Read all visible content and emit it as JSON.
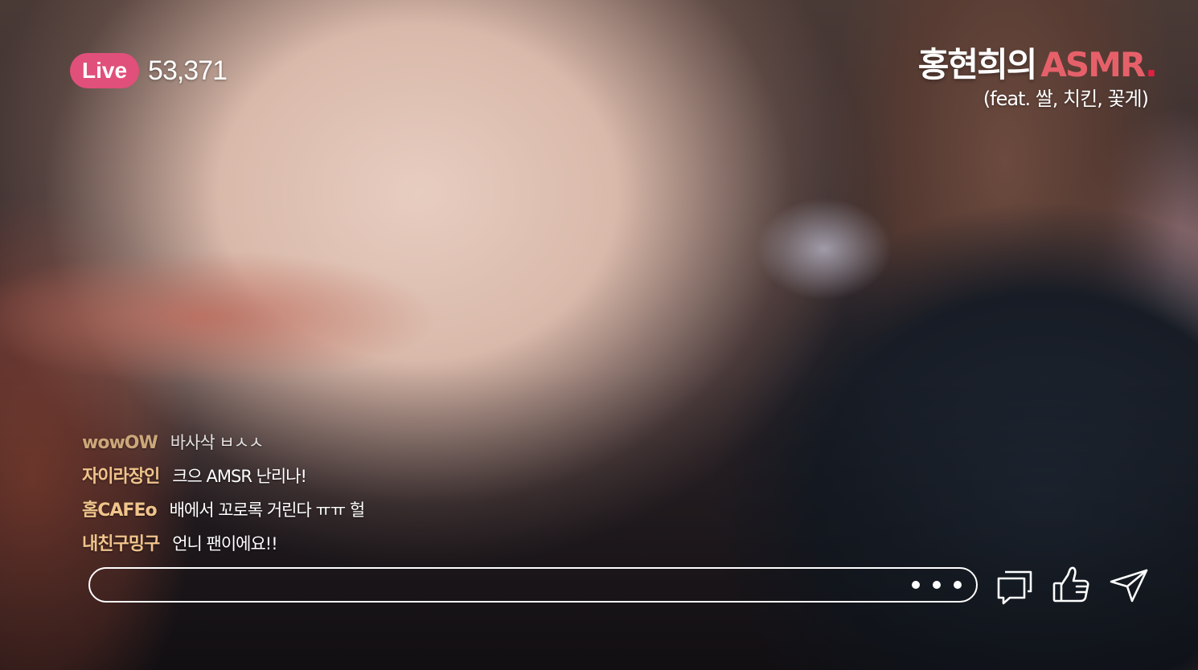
{
  "stream": {
    "live_label": "Live",
    "viewer_count": "53,371"
  },
  "title": {
    "main": "홍현희의",
    "accent": "ASMR",
    "dot": ".",
    "accent_color": "#e6606a",
    "subtitle": "(feat. 쌀, 치킨, 꽃게)"
  },
  "chat": {
    "messages": [
      {
        "user": "wowOW",
        "text": "바사삭 ㅂㅅㅅ"
      },
      {
        "user": "자이라장인",
        "text": "크으 AMSR 난리나!"
      },
      {
        "user": "홈CAFEo",
        "text": "배에서 꼬로록 거린다 ㅠㅠ 헐"
      },
      {
        "user": "내친구밍구",
        "text": "언니 팬이에요!!"
      }
    ]
  },
  "input": {
    "value": "",
    "placeholder": ""
  },
  "icons": {
    "more": "more-icon",
    "comments": "chat-bubble-icon",
    "like": "thumbs-up-icon",
    "share": "send-icon"
  },
  "colors": {
    "live_badge": "#e0507a",
    "username": "#f0c48c"
  }
}
